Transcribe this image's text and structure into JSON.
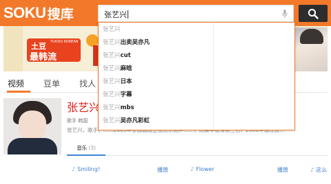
{
  "header": {
    "logo_en": "SOKU",
    "logo_cn": "搜库",
    "search": {
      "value": "张艺兴"
    },
    "icons": {
      "mic": "mic-icon",
      "search": "search-icon"
    },
    "colors": {
      "brand": "#f3792a",
      "button": "#2d2d2d"
    }
  },
  "banner": {
    "badge_top": "土豆",
    "badge_en": "TUDOU KOREAN",
    "badge_main": "最韩流"
  },
  "tabs": [
    {
      "label": "视频",
      "active": true
    },
    {
      "label": "豆单",
      "active": false
    },
    {
      "label": "找人",
      "active": false
    }
  ],
  "artist": {
    "name": "张艺兴",
    "meta": "歌手  韩国",
    "bio": "张艺兴，歌手，……2005年参加湖南卫视快乐男声……，比赛中取得第三名，2008年通过数…"
  },
  "sub_tabs": [
    {
      "label": "音乐",
      "count": "(3)"
    }
  ],
  "songs": [
    {
      "title": "Smiling!",
      "play": "播放"
    },
    {
      "title": "Flower",
      "play": "播放"
    },
    {
      "title": "这么",
      "play": ""
    }
  ],
  "suggestions": [
    {
      "prefix": "张艺兴",
      "rest": ""
    },
    {
      "prefix": "张艺兴",
      "rest": "出卖吴亦凡"
    },
    {
      "prefix": "张艺兴",
      "rest": "cut"
    },
    {
      "prefix": "张艺兴",
      "rest": "麻晗"
    },
    {
      "prefix": "张艺兴",
      "rest": "日本"
    },
    {
      "prefix": "张艺兴",
      "rest": "字幕"
    },
    {
      "prefix": "张艺兴",
      "rest": "mbs"
    },
    {
      "prefix": "张艺兴",
      "rest": "吴亦凡彩虹"
    }
  ]
}
